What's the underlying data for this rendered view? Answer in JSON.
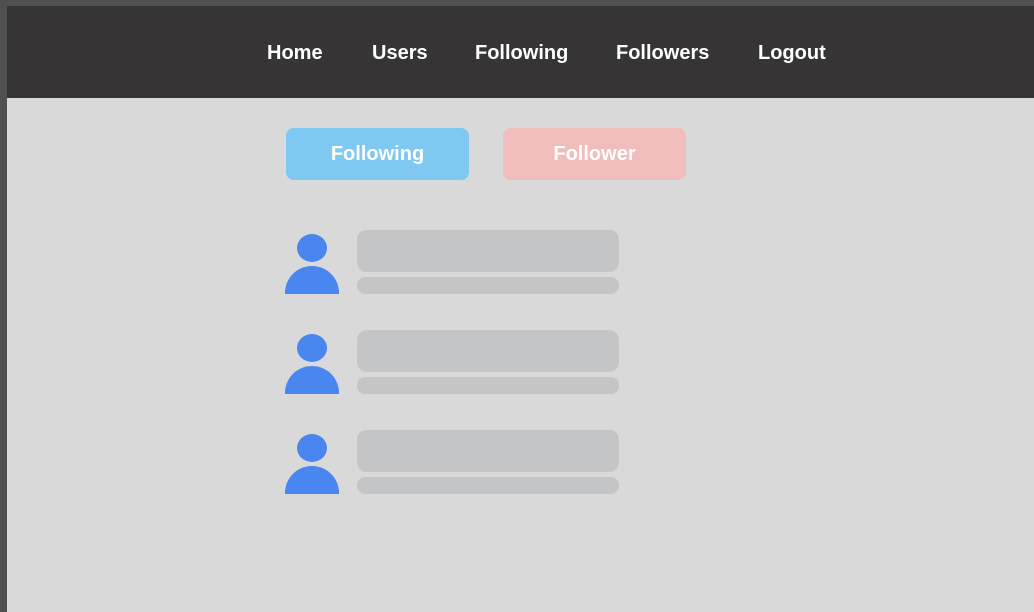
{
  "nav": {
    "items": [
      {
        "label": "Home"
      },
      {
        "label": "Users"
      },
      {
        "label": "Following"
      },
      {
        "label": "Followers"
      },
      {
        "label": "Logout"
      }
    ]
  },
  "tabs": {
    "following_label": "Following",
    "follower_label": "Follower"
  },
  "list": {
    "rows": [
      {
        "icon": "user-icon",
        "name": "",
        "subtitle": ""
      },
      {
        "icon": "user-icon",
        "name": "",
        "subtitle": ""
      },
      {
        "icon": "user-icon",
        "name": "",
        "subtitle": ""
      }
    ]
  },
  "colors": {
    "navbar_bg": "#363435",
    "page_bg": "#d9d9d9",
    "following_tab": "#7fc8f1",
    "follower_tab": "#f0bcbc",
    "avatar": "#4a86f0",
    "placeholder": "#c4c5c7"
  }
}
